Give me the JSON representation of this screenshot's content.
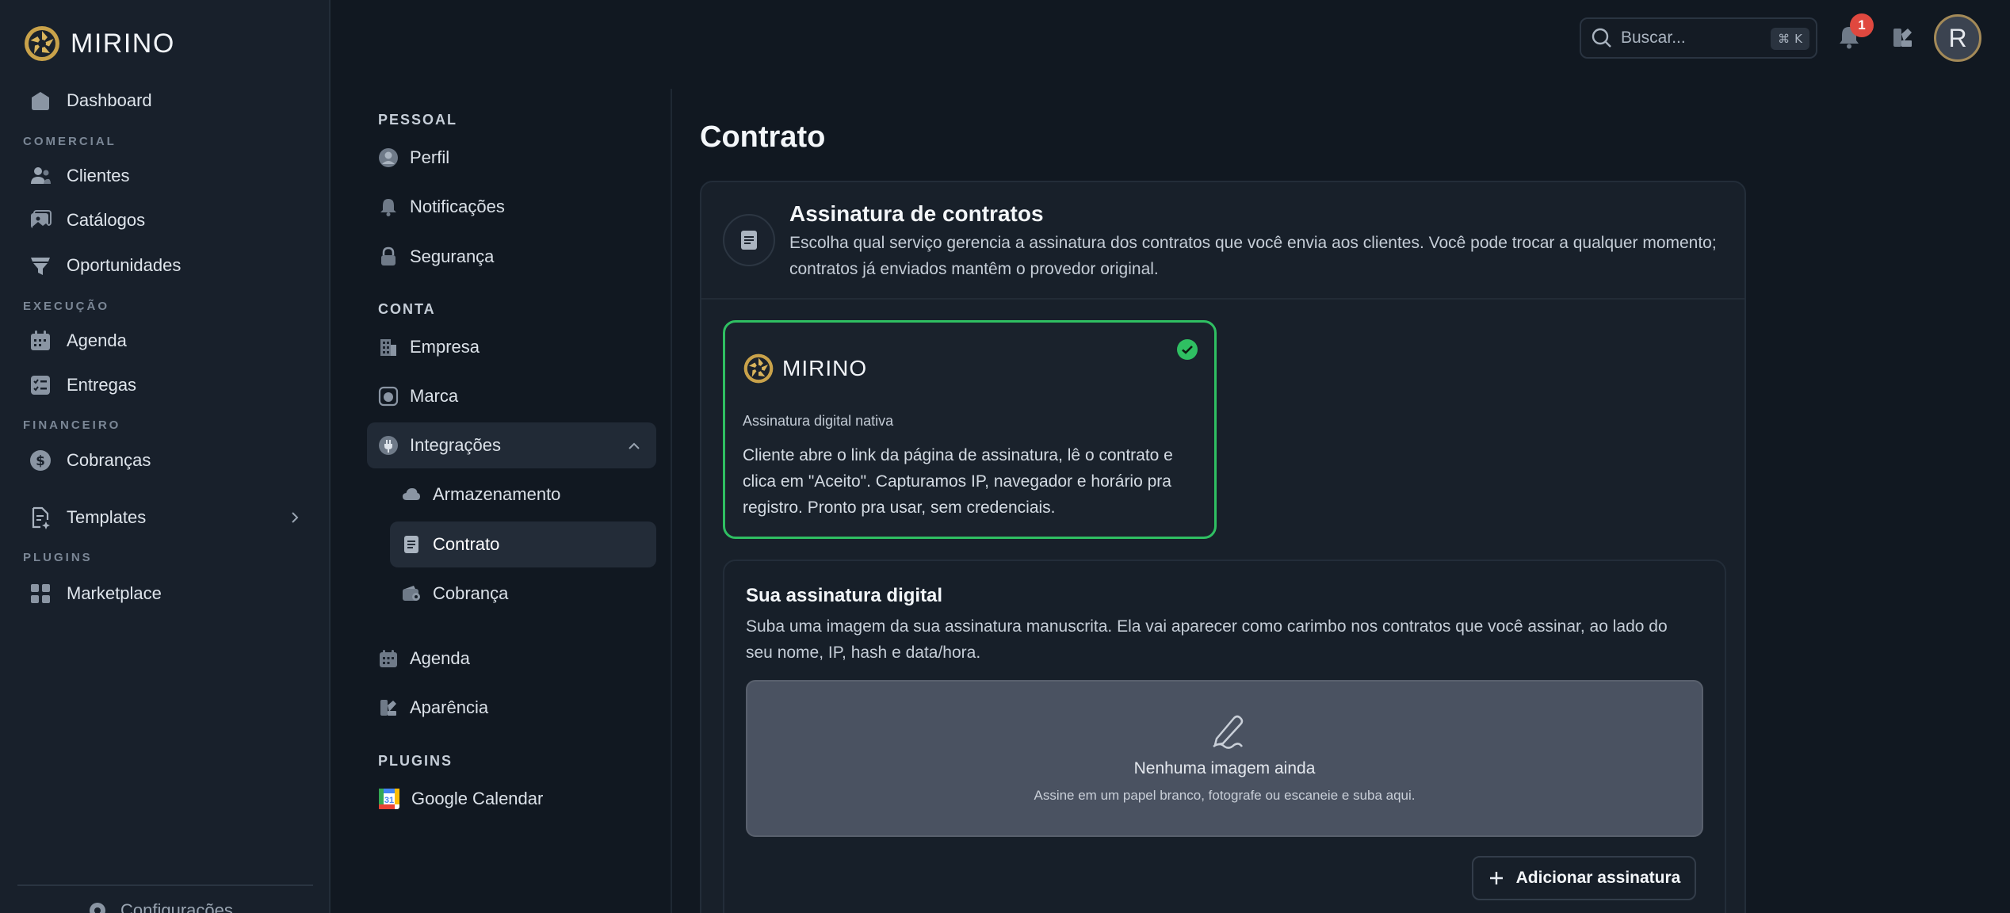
{
  "brand": {
    "name": "MIRINO"
  },
  "sidebar": {
    "dashboard": "Dashboard",
    "sections": {
      "comercial": "COMERCIAL",
      "execucao": "EXECUÇÃO",
      "financeiro": "FINANCEIRO",
      "plugins": "PLUGINS"
    },
    "clientes": "Clientes",
    "catalogos": "Catálogos",
    "oportunidades": "Oportunidades",
    "agenda": "Agenda",
    "entregas": "Entregas",
    "cobrancas": "Cobranças",
    "templates": "Templates",
    "marketplace": "Marketplace",
    "configuracoes": "Configurações"
  },
  "settings_nav": {
    "pessoal": "PESSOAL",
    "perfil": "Perfil",
    "notificacoes": "Notificações",
    "seguranca": "Segurança",
    "conta": "CONTA",
    "empresa": "Empresa",
    "marca": "Marca",
    "integracoes": "Integrações",
    "armazenamento": "Armazenamento",
    "contrato": "Contrato",
    "cobranca": "Cobrança",
    "agenda": "Agenda",
    "aparencia": "Aparência",
    "plugins": "PLUGINS",
    "google_calendar": "Google Calendar"
  },
  "topbar": {
    "search_placeholder": "Buscar...",
    "shortcut_symbol": "⌘",
    "shortcut_key": "K",
    "notification_count": "1",
    "avatar_initial": "R"
  },
  "main": {
    "title": "Contrato",
    "card": {
      "title": "Assinatura de contratos",
      "description": "Escolha qual serviço gerencia a assinatura dos contratos que você envia aos clientes. Você pode trocar a qualquer momento; contratos já enviados mantêm o provedor original."
    },
    "provider": {
      "name": "MIRINO",
      "subtitle": "Assinatura digital nativa",
      "description": "Cliente abre o link da página de assinatura, lê o contrato e clica em \"Aceito\". Capturamos IP, navegador e horário pra registro. Pronto pra usar, sem credenciais.",
      "selected": true
    },
    "signature": {
      "title": "Sua assinatura digital",
      "description": "Suba uma imagem da sua assinatura manuscrita. Ela vai aparecer como carimbo nos contratos que você assinar, ao lado do seu nome, IP, hash e data/hora.",
      "empty_title": "Nenhuma imagem ainda",
      "empty_hint": "Assine em um papel branco, fotografe ou escaneie e suba aqui.",
      "add_button": "Adicionar assinatura"
    }
  },
  "colors": {
    "accent_green": "#2fbf62",
    "badge_red": "#e0483f",
    "brand_gold": "#c9a24a",
    "background": "#111821",
    "sidebar": "#18202b"
  }
}
